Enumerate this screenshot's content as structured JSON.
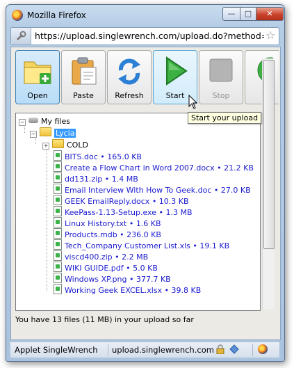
{
  "window": {
    "title": "Mozilla Firefox",
    "minimize_glyph": "—",
    "maximize_glyph": "□",
    "close_glyph": "✕"
  },
  "address": {
    "url": "https://upload.singlewrench.com/upload.do?method=start",
    "star": "☆"
  },
  "toolbar": {
    "buttons": [
      {
        "label": "Open",
        "icon": "open-folder-icon"
      },
      {
        "label": "Paste",
        "icon": "clipboard-icon"
      },
      {
        "label": "Refresh",
        "icon": "refresh-icon"
      },
      {
        "label": "Start",
        "icon": "play-icon"
      },
      {
        "label": "Stop",
        "icon": "stop-icon"
      }
    ]
  },
  "tooltip": "Start your upload",
  "tree": {
    "root": "My files",
    "folder": "Lycia",
    "subfolder": "COLD",
    "files": [
      "BITS.doc • 165.0 KB",
      "Create a Flow Chart in Word 2007.docx • 21.2 KB",
      "dd131.zip • 1.4 MB",
      "Email Interview With How To Geek.doc • 27.0 KB",
      "GEEK EmailReply.docx • 10.3 KB",
      "KeePass-1.13-Setup.exe • 1.3 MB",
      "Linux History.txt • 1.6 KB",
      "Products.mdb • 236.0 KB",
      "Tech_Company Customer List.xls • 19.1 KB",
      "viscd400.zip • 2.2 MB",
      "WIKI GUIDE.pdf • 5.0 KB",
      "Windows XP.png • 377.7 KB",
      "Working Geek EXCEL.xlsx • 39.8 KB"
    ]
  },
  "status_message": "You have 13 files (11 MB) in your upload so far",
  "statusbar": {
    "applet": "Applet SingleWrench",
    "domain": "upload.singlewrench.com"
  },
  "colors": {
    "file_link": "#1a1ad0",
    "selection": "#3399ff",
    "tooltip_bg": "#ffffe1"
  }
}
